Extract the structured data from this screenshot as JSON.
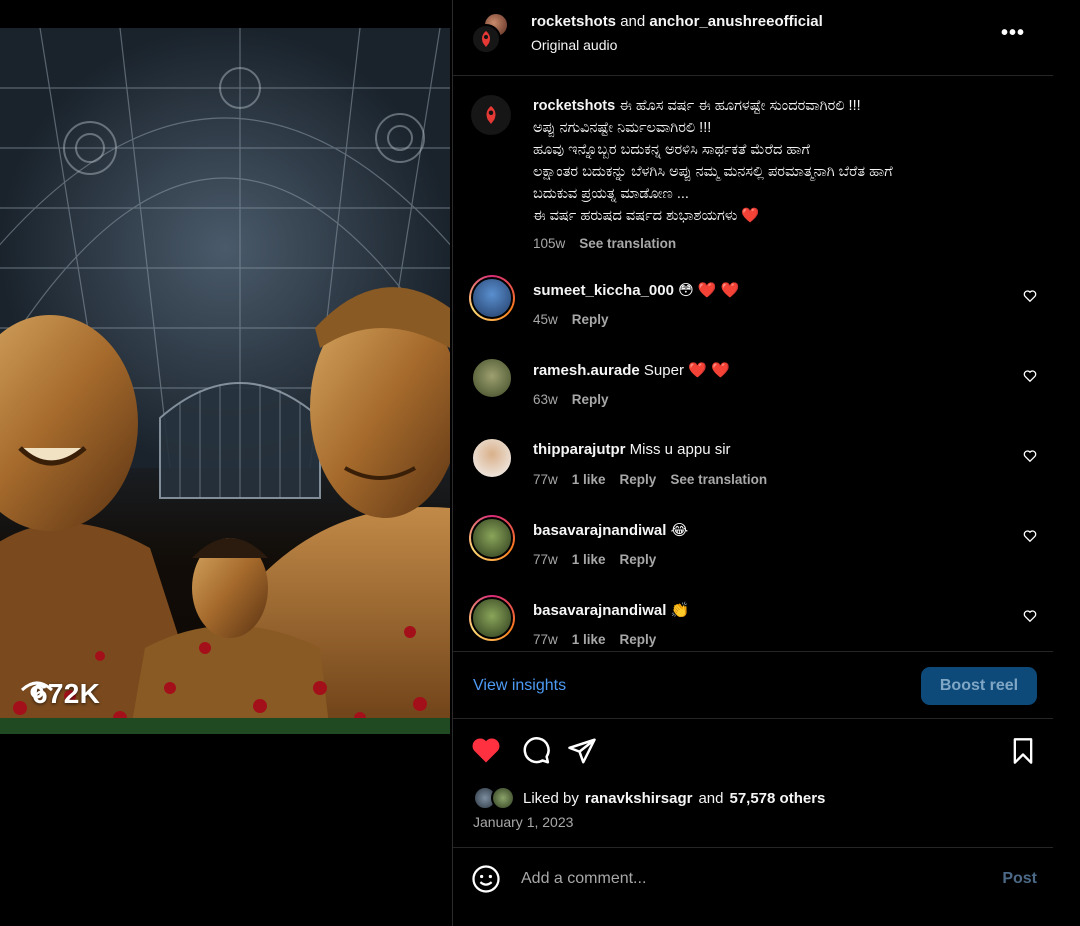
{
  "media": {
    "views_count": "672K",
    "view_icon": "eye-icon"
  },
  "header": {
    "user1": "rocketshots",
    "joiner": "and",
    "user2": "anchor_anushreeofficial",
    "audio": "Original audio",
    "more_icon": "more-horizontal-icon"
  },
  "caption": {
    "username": "rocketshots",
    "lines": [
      "ಈ ಹೊಸ ವರ್ಷ ಈ ಹೂಗಳಷ್ಟೇ ಸುಂದರವಾಗಿರಲಿ !!!",
      "ಅಪ್ಪು ನಗುವಿನಷ್ಟೇ ನಿರ್ಮಲವಾಗಿರಲಿ !!!",
      "ಹೂವು ಇನ್ನೊಬ್ಬರ ಬದುಕನ್ನ ಅರಳಿಸಿ ಸಾರ್ಥಕತೆ ಮೆರೆದ ಹಾಗೆ",
      "ಲಕ್ಷಾಂತರ ಬದುಕನ್ನು ಬೆಳಗಿಸಿ ಅಪ್ಪು ನಮ್ಮ ಮನಸಲ್ಲಿ ಪರಮಾತ್ಮನಾಗಿ ಬೆರೆತ ಹಾಗೆ",
      "ಬದುಕುವ ಪ್ರಯತ್ನ ಮಾಡೋಣ ...",
      "ಈ ವರ್ಷ ಹರುಷದ ವರ್ಷದ ಶುಭಾಶಯಗಳು ❤️"
    ],
    "time": "105w",
    "see_translation": "See translation"
  },
  "comments": [
    {
      "username": "sumeet_kiccha_000",
      "text": "😳 ❤️ ❤️",
      "time": "45w",
      "likes": "",
      "reply": "Reply",
      "translate": ""
    },
    {
      "username": "ramesh.aurade",
      "text": "Super ❤️ ❤️",
      "time": "63w",
      "likes": "",
      "reply": "Reply",
      "translate": ""
    },
    {
      "username": "thipparajutpr",
      "text": "Miss u appu sir",
      "time": "77w",
      "likes": "1 like",
      "reply": "Reply",
      "translate": "See translation"
    },
    {
      "username": "basavarajnandiwal",
      "text": "😂",
      "time": "77w",
      "likes": "1 like",
      "reply": "Reply",
      "translate": ""
    },
    {
      "username": "basavarajnandiwal",
      "text": "👏",
      "time": "77w",
      "likes": "1 like",
      "reply": "Reply",
      "translate": ""
    }
  ],
  "insights": {
    "view_insights": "View insights",
    "boost": "Boost reel"
  },
  "actions": {
    "liked": true,
    "icons": [
      "heart-filled-icon",
      "comment-icon",
      "share-icon",
      "bookmark-icon"
    ]
  },
  "likes": {
    "prefix": "Liked by",
    "user": "ranavkshirsagr",
    "joiner": "and",
    "others": "57,578 others",
    "date": "January 1, 2023"
  },
  "add_comment": {
    "placeholder": "Add a comment...",
    "post": "Post"
  },
  "colors": {
    "link": "#4e9bf5",
    "heart": "#ff3040",
    "boost_bg": "#0d4a7a"
  }
}
